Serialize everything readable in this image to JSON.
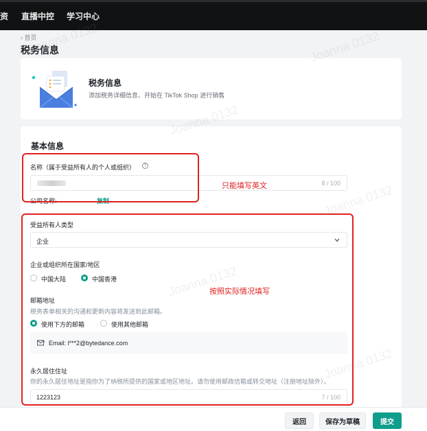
{
  "nav": {
    "item_cut": "资",
    "item_live": "直播中控",
    "item_learning": "学习中心"
  },
  "breadcrumb": "‹ 首页",
  "page_title": "税务信息",
  "intro_card": {
    "title": "税务信息",
    "subtitle": "添加税务详细信息、开始在 TikTok Shop 进行销售"
  },
  "basic_info": {
    "section_title": "基本信息",
    "name_label": "名称（属于受益所有人的个人或组织）",
    "name_counter": "8 / 100",
    "company_label": "公司名称:",
    "company_value": "..",
    "copy_link": "复制",
    "owner_type_label": "受益所有人类型",
    "owner_type_value": "企业",
    "country_label": "企业或组织所在国家/地区",
    "country_options": [
      "中国大陆",
      "中国香港"
    ],
    "country_selected": "中国香港",
    "email_label": "邮箱地址",
    "email_hint": "税务表单相关的沟通和更新内容将发送到此邮箱。",
    "email_options": [
      "使用下方的邮箱",
      "使用其他邮箱"
    ],
    "email_selected": "使用下方的邮箱",
    "email_value": "Email: l***2@bytedance.com",
    "address_label": "永久居住住址",
    "address_hint": "你的永久居住地址是指你为了纳税所提供的国家或地区地址。请勿使用邮政信箱或转交地址（注册地址除外）。",
    "address_value": "1223123",
    "address_counter": "7 / 100"
  },
  "annotations": {
    "name_note": "只能填写英文",
    "info_note": "按照实际情况填写"
  },
  "watermark": "Joanna 0132",
  "footer": {
    "back": "返回",
    "save_draft": "保存为草稿",
    "submit": "提交"
  },
  "colors": {
    "accent": "#0f9d8c",
    "annotation": "#e02020",
    "nav_bg": "#111214"
  }
}
